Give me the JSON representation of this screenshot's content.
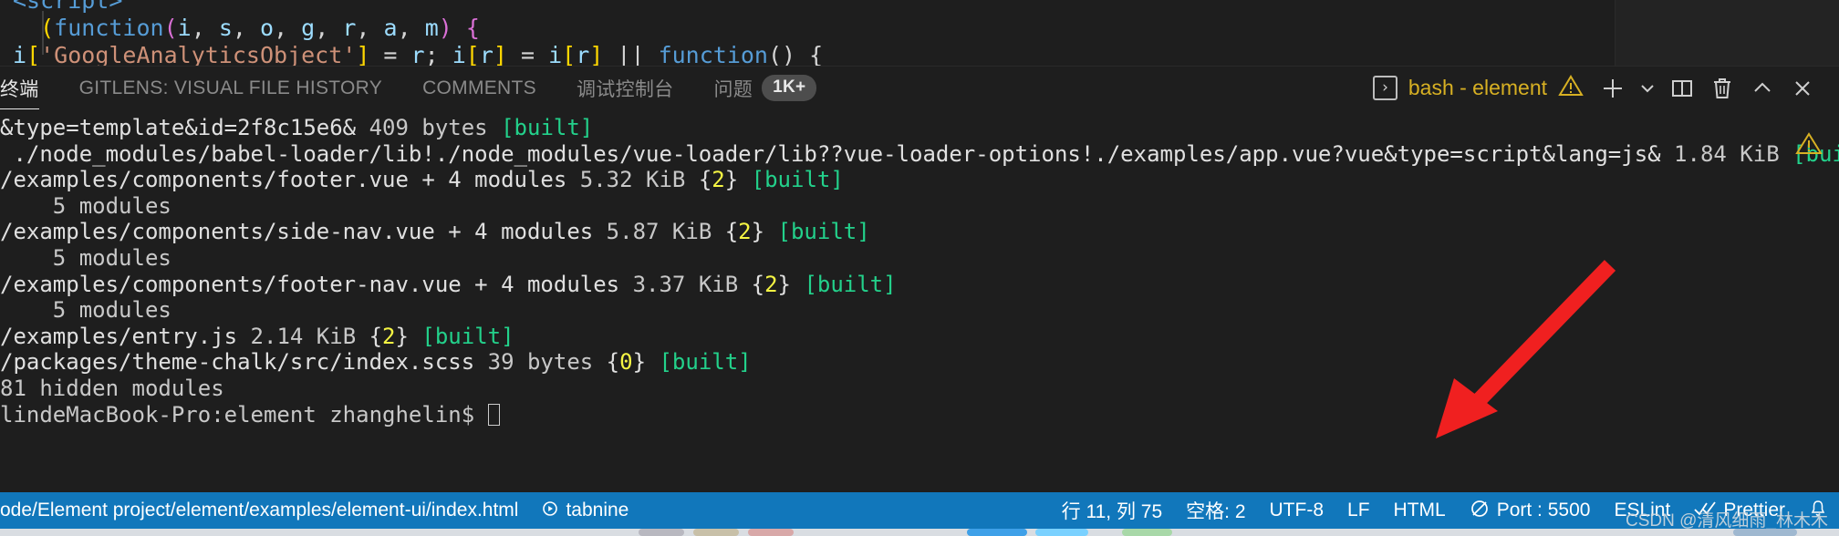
{
  "editor": {
    "lines": [
      {
        "segments": [
          {
            "t": "<script>",
            "c": "tk-tag"
          }
        ]
      },
      {
        "segments": [
          {
            "t": "  ",
            "c": "tk-plain"
          },
          {
            "t": "(",
            "c": "tk-yellow"
          },
          {
            "t": "function",
            "c": "tk-kw"
          },
          {
            "t": "(",
            "c": "tk-pink"
          },
          {
            "t": "i",
            "c": "tk-param"
          },
          {
            "t": ", ",
            "c": "tk-plain"
          },
          {
            "t": "s",
            "c": "tk-param"
          },
          {
            "t": ", ",
            "c": "tk-plain"
          },
          {
            "t": "o",
            "c": "tk-param"
          },
          {
            "t": ", ",
            "c": "tk-plain"
          },
          {
            "t": "g",
            "c": "tk-param"
          },
          {
            "t": ", ",
            "c": "tk-plain"
          },
          {
            "t": "r",
            "c": "tk-param"
          },
          {
            "t": ", ",
            "c": "tk-plain"
          },
          {
            "t": "a",
            "c": "tk-param"
          },
          {
            "t": ", ",
            "c": "tk-plain"
          },
          {
            "t": "m",
            "c": "tk-param"
          },
          {
            "t": ")",
            "c": "tk-pink"
          },
          {
            "t": " ",
            "c": "tk-plain"
          },
          {
            "t": "{",
            "c": "tk-pink"
          }
        ]
      },
      {
        "segments": [
          {
            "t": "i",
            "c": "tk-param"
          },
          {
            "t": "[",
            "c": "tk-yellow"
          },
          {
            "t": "'GoogleAnalyticsObject'",
            "c": "tk-str"
          },
          {
            "t": "]",
            "c": "tk-yellow"
          },
          {
            "t": " = ",
            "c": "tk-plain"
          },
          {
            "t": "r",
            "c": "tk-param"
          },
          {
            "t": "; ",
            "c": "tk-plain"
          },
          {
            "t": "i",
            "c": "tk-param"
          },
          {
            "t": "[",
            "c": "tk-yellow"
          },
          {
            "t": "r",
            "c": "tk-param"
          },
          {
            "t": "]",
            "c": "tk-yellow"
          },
          {
            "t": " = ",
            "c": "tk-plain"
          },
          {
            "t": "i",
            "c": "tk-param"
          },
          {
            "t": "[",
            "c": "tk-yellow"
          },
          {
            "t": "r",
            "c": "tk-param"
          },
          {
            "t": "]",
            "c": "tk-yellow"
          },
          {
            "t": " || ",
            "c": "tk-plain"
          },
          {
            "t": "function",
            "c": "tk-kw"
          },
          {
            "t": "() {",
            "c": "tk-plain"
          }
        ]
      }
    ]
  },
  "panel": {
    "tabs": [
      {
        "label": "终端",
        "active": true,
        "badge": null
      },
      {
        "label": "GITLENS: VISUAL FILE HISTORY",
        "active": false,
        "badge": null
      },
      {
        "label": "COMMENTS",
        "active": false,
        "badge": null
      },
      {
        "label": "调试控制台",
        "active": false,
        "badge": null
      },
      {
        "label": "问题",
        "active": false,
        "badge": "1K+"
      }
    ],
    "terminal_selector": {
      "glyph": "›",
      "name": "bash - element",
      "warning_glyph": "⚠"
    },
    "actions": [
      {
        "name": "new-terminal-button",
        "icon": "plus"
      },
      {
        "name": "terminal-dropdown-button",
        "icon": "chevron-down"
      },
      {
        "name": "split-terminal-button",
        "icon": "split"
      },
      {
        "name": "kill-terminal-button",
        "icon": "trash"
      },
      {
        "name": "maximize-panel-button",
        "icon": "chevron-up"
      },
      {
        "name": "close-panel-button",
        "icon": "close"
      }
    ]
  },
  "terminal": {
    "warning_marker": "⚠",
    "lines": [
      {
        "segments": [
          {
            "t": "&type=template&id=2f8c15e6&",
            "c": "t-white"
          },
          {
            "t": " 409 bytes ",
            "c": "t-dim"
          },
          {
            "t": "[built]",
            "c": "t-green"
          }
        ]
      },
      {
        "segments": [
          {
            "t": " ./node_modules/babel-loader/lib!./node_modules/vue-loader/lib??vue-loader-options!./examples/app.vue?vue&type=script&lang=js&",
            "c": "t-white"
          },
          {
            "t": " 1.84 KiB ",
            "c": "t-dim"
          },
          {
            "t": "[built",
            "c": "t-green"
          }
        ]
      },
      {
        "segments": [
          {
            "t": "",
            "c": "t-white"
          }
        ]
      },
      {
        "segments": [
          {
            "t": "/examples/components/footer.vue + 4 modules",
            "c": "t-white"
          },
          {
            "t": " 5.32 KiB ",
            "c": "t-dim"
          },
          {
            "t": "{",
            "c": "t-white"
          },
          {
            "t": "2",
            "c": "t-yellow"
          },
          {
            "t": "} ",
            "c": "t-white"
          },
          {
            "t": "[built]",
            "c": "t-green"
          }
        ]
      },
      {
        "segments": [
          {
            "t": "    5 modules",
            "c": "t-dim"
          }
        ]
      },
      {
        "segments": [
          {
            "t": "/examples/components/side-nav.vue + 4 modules",
            "c": "t-white"
          },
          {
            "t": " 5.87 KiB ",
            "c": "t-dim"
          },
          {
            "t": "{",
            "c": "t-white"
          },
          {
            "t": "2",
            "c": "t-yellow"
          },
          {
            "t": "} ",
            "c": "t-white"
          },
          {
            "t": "[built]",
            "c": "t-green"
          }
        ]
      },
      {
        "segments": [
          {
            "t": "    5 modules",
            "c": "t-dim"
          }
        ]
      },
      {
        "segments": [
          {
            "t": "/examples/components/footer-nav.vue + 4 modules",
            "c": "t-white"
          },
          {
            "t": " 3.37 KiB ",
            "c": "t-dim"
          },
          {
            "t": "{",
            "c": "t-white"
          },
          {
            "t": "2",
            "c": "t-yellow"
          },
          {
            "t": "} ",
            "c": "t-white"
          },
          {
            "t": "[built]",
            "c": "t-green"
          }
        ]
      },
      {
        "segments": [
          {
            "t": "    5 modules",
            "c": "t-dim"
          }
        ]
      },
      {
        "segments": [
          {
            "t": "/examples/entry.js",
            "c": "t-white"
          },
          {
            "t": " 2.14 KiB ",
            "c": "t-dim"
          },
          {
            "t": "{",
            "c": "t-white"
          },
          {
            "t": "2",
            "c": "t-yellow"
          },
          {
            "t": "} ",
            "c": "t-white"
          },
          {
            "t": "[built]",
            "c": "t-green"
          }
        ]
      },
      {
        "segments": [
          {
            "t": "/packages/theme-chalk/src/index.scss",
            "c": "t-white"
          },
          {
            "t": " 39 bytes ",
            "c": "t-dim"
          },
          {
            "t": "{",
            "c": "t-white"
          },
          {
            "t": "0",
            "c": "t-yellow"
          },
          {
            "t": "} ",
            "c": "t-white"
          },
          {
            "t": "[built]",
            "c": "t-green"
          }
        ]
      },
      {
        "segments": [
          {
            "t": "81 hidden modules",
            "c": "t-dim"
          }
        ]
      },
      {
        "segments": [
          {
            "t": "lindeMacBook-Pro:element zhanghelin$ ",
            "c": "t-dim"
          },
          {
            "t": "__CURSOR__",
            "c": "cursor"
          }
        ]
      }
    ]
  },
  "status_bar": {
    "left": [
      {
        "name": "file-path",
        "label": "ode/Element project/element/examples/element-ui/index.html",
        "icon": null
      },
      {
        "name": "tabnine",
        "label": "tabnine",
        "icon": "circle-play"
      }
    ],
    "right": [
      {
        "name": "cursor-position",
        "label": "行 11, 列 75",
        "icon": null
      },
      {
        "name": "indentation",
        "label": "空格: 2",
        "icon": null
      },
      {
        "name": "encoding",
        "label": "UTF-8",
        "icon": null
      },
      {
        "name": "eol",
        "label": "LF",
        "icon": null
      },
      {
        "name": "language-mode",
        "label": "HTML",
        "icon": null
      },
      {
        "name": "live-server-port",
        "label": "Port : 5500",
        "icon": "broadcast"
      },
      {
        "name": "eslint",
        "label": "ESLint",
        "icon": null
      },
      {
        "name": "prettier",
        "label": "Prettier",
        "icon": "check-check"
      },
      {
        "name": "remote-bell",
        "label": "",
        "icon": "bell"
      }
    ],
    "accent_color": "#1177bb"
  },
  "annotation": {
    "arrow_color": "#f02020"
  },
  "watermark": {
    "text": "CSDN @清风细雨_林木木"
  }
}
